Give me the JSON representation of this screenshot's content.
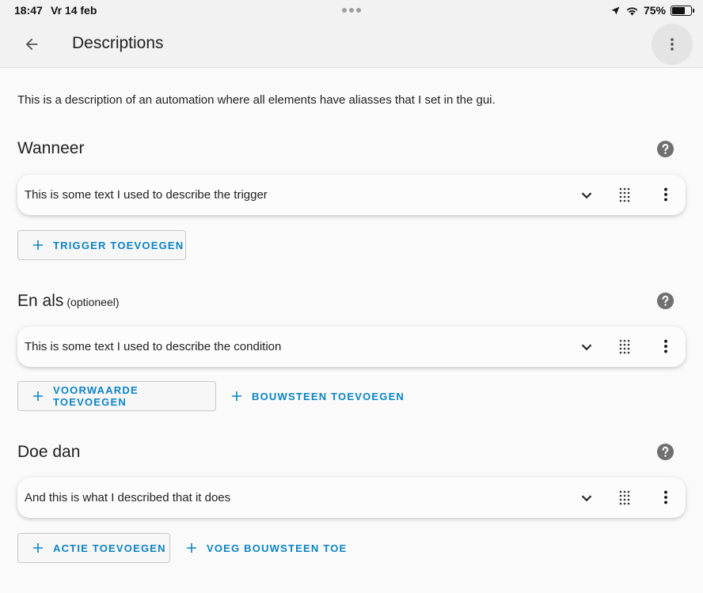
{
  "status_bar": {
    "time": "18:47",
    "date": "Vr 14 feb",
    "battery_percent": "75%",
    "battery_level": 0.75,
    "icons": [
      "location-arrow-icon",
      "wifi-icon",
      "battery-icon"
    ]
  },
  "app_bar": {
    "title": "Descriptions",
    "back_icon": "arrow-left-icon",
    "menu_icon": "more-vertical-icon"
  },
  "description": "This is a description of an automation where all elements have aliasses that I set in the gui.",
  "sections": {
    "triggers": {
      "title": "Wanneer",
      "item_text": "This is some text I used to describe the trigger",
      "add_button": "TRIGGER TOEVOEGEN"
    },
    "conditions": {
      "title": "En als",
      "optional_label": "(optioneel)",
      "item_text": "This is some text I used to describe the condition",
      "add_button": "VOORWAARDE TOEVOEGEN",
      "add_building_block": "BOUWSTEEN TOEVOEGEN"
    },
    "actions": {
      "title": "Doe dan",
      "item_text": "And this is what I described that it does",
      "add_button": "ACTIE TOEVOEGEN",
      "add_building_block": "VOEG BOUWSTEEN TOE"
    }
  },
  "colors": {
    "accent": "#0b83c6",
    "background": "#fafafa",
    "app_bar": "#f2f2f2",
    "help_icon": "#707070"
  }
}
